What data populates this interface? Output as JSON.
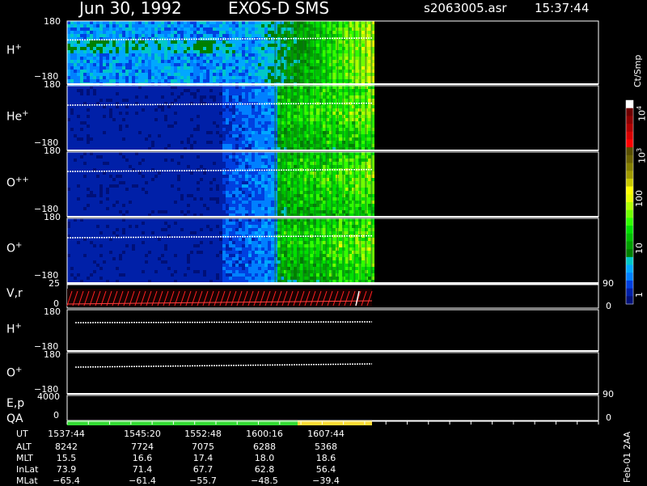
{
  "header": {
    "date": "Jun 30, 1992",
    "instrument": "EXOS-D SMS",
    "file": "s2063005.asr",
    "time": "15:37:44"
  },
  "panels": [
    {
      "species": "H",
      "charge": "+",
      "tick_top": "180",
      "tick_bottom": "−180"
    },
    {
      "species": "He",
      "charge": "+",
      "tick_top": "180",
      "tick_bottom": "−180"
    },
    {
      "species": "O",
      "charge": "++",
      "tick_top": "180",
      "tick_bottom": "−180"
    },
    {
      "species": "O",
      "charge": "+",
      "tick_top": "180",
      "tick_bottom": "−180"
    }
  ],
  "vr_panel": {
    "label": "V,r",
    "left_top": "25",
    "left_bottom": "0",
    "right_top": "90",
    "right_bottom": "0"
  },
  "low_panels": [
    {
      "species": "H",
      "charge": "+",
      "tick_top": "180",
      "tick_bottom": "−180"
    },
    {
      "species": "O",
      "charge": "+",
      "tick_top": "180",
      "tick_bottom": "−180"
    }
  ],
  "ep_panel": {
    "label": "E,p",
    "left_top": "4000",
    "right_top": "90"
  },
  "qa_panel": {
    "label": "QA",
    "left_bottom": "0",
    "right_bottom": "0"
  },
  "colorbar": {
    "unit": "Ct/Smp",
    "ticks": [
      "10",
      "10",
      "100",
      "10",
      "1"
    ],
    "ticks_exp": [
      "4",
      "3",
      "",
      "",
      ""
    ],
    "colors": [
      "#ffffff",
      "#700000",
      "#900000",
      "#b00000",
      "#d80000",
      "#ff0000",
      "#5a5000",
      "#6e6400",
      "#868000",
      "#a09a00",
      "#c8c800",
      "#ffff00",
      "#e8ff00",
      "#b0ff00",
      "#70ff00",
      "#30ff00",
      "#00e000",
      "#00c000",
      "#00a000",
      "#008000",
      "#00c8c8",
      "#00a8ff",
      "#0080ff",
      "#0040e0",
      "#0020a8",
      "#001078"
    ]
  },
  "footer": {
    "row_labels": [
      "UT",
      "ALT",
      "MLT",
      "InLat",
      "MLat"
    ],
    "columns": [
      {
        "UT": "1537:44",
        "ALT": "8242",
        "MLT": "15.5",
        "InLat": "73.9",
        "MLat": "−65.4"
      },
      {
        "UT": "1545:20",
        "ALT": "7724",
        "MLT": "16.6",
        "InLat": "71.4",
        "MLat": "−61.4"
      },
      {
        "UT": "1552:48",
        "ALT": "7075",
        "MLT": "17.4",
        "InLat": "67.7",
        "MLat": "−55.7"
      },
      {
        "UT": "1600:16",
        "ALT": "6288",
        "MLT": "18.0",
        "InLat": "62.8",
        "MLat": "−48.5"
      },
      {
        "UT": "1607:44",
        "ALT": "5368",
        "MLT": "18.6",
        "InLat": "56.4",
        "MLat": "−39.4"
      }
    ],
    "side_note": "Feb-01 2AA"
  },
  "chart_data": {
    "type": "heatmap",
    "title": "Jun 30, 1992   EXOS-D SMS",
    "x": [
      "1537:44",
      "1545:20",
      "1552:48",
      "1600:16",
      "1607:44"
    ],
    "ylim_pitch_angle": [
      -180,
      180
    ],
    "vr_ylim": [
      0,
      25
    ],
    "ep_ylim": [
      0,
      4000
    ],
    "colorbar_range": [
      1,
      10000
    ],
    "colorbar_scale": "log",
    "qa_segments": [
      {
        "from": "1537:44",
        "to": "1607:44",
        "color": "#33dd33"
      },
      {
        "from": "1607:44",
        "to": "end",
        "color": "#ffdd33"
      }
    ]
  }
}
